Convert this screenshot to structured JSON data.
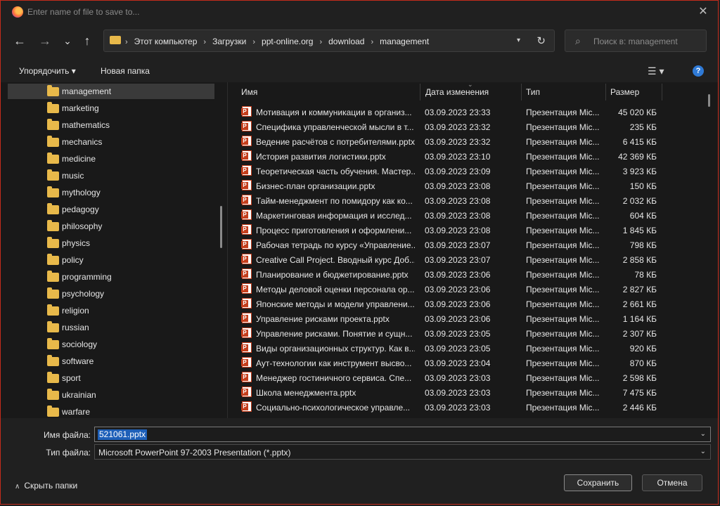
{
  "titlebar": {
    "title": "Enter name of file to save to..."
  },
  "nav": {
    "back": "←",
    "forward": "→",
    "recent": "⌄",
    "up": "↑"
  },
  "address": {
    "crumbs": [
      "Этот компьютер",
      "Загрузки",
      "ppt-online.org",
      "download",
      "management"
    ],
    "refresh": "↻"
  },
  "search": {
    "placeholder": "Поиск в: management"
  },
  "toolbar": {
    "organize_label": "Упорядочить ▾",
    "new_folder_label": "Новая папка",
    "help": "?"
  },
  "sidebar": {
    "selected_index": 0,
    "items": [
      {
        "label": "management"
      },
      {
        "label": "marketing"
      },
      {
        "label": "mathematics"
      },
      {
        "label": "mechanics"
      },
      {
        "label": "medicine"
      },
      {
        "label": "music"
      },
      {
        "label": "mythology"
      },
      {
        "label": "pedagogy"
      },
      {
        "label": "philosophy"
      },
      {
        "label": "physics"
      },
      {
        "label": "policy"
      },
      {
        "label": "programming"
      },
      {
        "label": "psychology"
      },
      {
        "label": "religion"
      },
      {
        "label": "russian"
      },
      {
        "label": "sociology"
      },
      {
        "label": "software"
      },
      {
        "label": "sport"
      },
      {
        "label": "ukrainian"
      },
      {
        "label": "warfare"
      }
    ]
  },
  "filelist": {
    "columns": {
      "name": "Имя",
      "date": "Дата изменения",
      "type": "Тип",
      "size": "Размер"
    },
    "rows": [
      {
        "name": "Мотивация и коммуникации в организ...",
        "date": "03.09.2023 23:33",
        "type": "Презентация Mic...",
        "size": "45 020 КБ"
      },
      {
        "name": "Специфика управленческой мысли в т...",
        "date": "03.09.2023 23:32",
        "type": "Презентация Mic...",
        "size": "235 КБ"
      },
      {
        "name": "Ведение расчётов с потребителями.pptx",
        "date": "03.09.2023 23:32",
        "type": "Презентация Mic...",
        "size": "6 415 КБ"
      },
      {
        "name": "История развития логистики.pptx",
        "date": "03.09.2023 23:10",
        "type": "Презентация Mic...",
        "size": "42 369 КБ"
      },
      {
        "name": "Теоретическая часть обучения. Мастер...",
        "date": "03.09.2023 23:09",
        "type": "Презентация Mic...",
        "size": "3 923 КБ"
      },
      {
        "name": "Бизнес-план организации.pptx",
        "date": "03.09.2023 23:08",
        "type": "Презентация Mic...",
        "size": "150 КБ"
      },
      {
        "name": "Тайм-менеджмент по помидору как ко...",
        "date": "03.09.2023 23:08",
        "type": "Презентация Mic...",
        "size": "2 032 КБ"
      },
      {
        "name": "Маркетинговая информация и исслед...",
        "date": "03.09.2023 23:08",
        "type": "Презентация Mic...",
        "size": "604 КБ"
      },
      {
        "name": "Процесс приготовления и оформлени...",
        "date": "03.09.2023 23:08",
        "type": "Презентация Mic...",
        "size": "1 845 КБ"
      },
      {
        "name": "Рабочая тетрадь по курсу «Управление...",
        "date": "03.09.2023 23:07",
        "type": "Презентация Mic...",
        "size": "798 КБ"
      },
      {
        "name": "Creative Call Project. Вводный курс Доб...",
        "date": "03.09.2023 23:07",
        "type": "Презентация Mic...",
        "size": "2 858 КБ"
      },
      {
        "name": "Планирование и бюджетирование.pptx",
        "date": "03.09.2023 23:06",
        "type": "Презентация Mic...",
        "size": "78 КБ"
      },
      {
        "name": "Методы деловой оценки персонала ор...",
        "date": "03.09.2023 23:06",
        "type": "Презентация Mic...",
        "size": "2 827 КБ"
      },
      {
        "name": "Японские методы и модели управлени...",
        "date": "03.09.2023 23:06",
        "type": "Презентация Mic...",
        "size": "2 661 КБ"
      },
      {
        "name": "Управление рисками проекта.pptx",
        "date": "03.09.2023 23:06",
        "type": "Презентация Mic...",
        "size": "1 164 КБ"
      },
      {
        "name": "Управление рисками. Понятие и сущн...",
        "date": "03.09.2023 23:05",
        "type": "Презентация Mic...",
        "size": "2 307 КБ"
      },
      {
        "name": "Виды организационных структур. Как в...",
        "date": "03.09.2023 23:05",
        "type": "Презентация Mic...",
        "size": "920 КБ"
      },
      {
        "name": "Аут-технологии как инструмент высво...",
        "date": "03.09.2023 23:04",
        "type": "Презентация Mic...",
        "size": "870 КБ"
      },
      {
        "name": "Менеджер гостиничного сервиса. Спе...",
        "date": "03.09.2023 23:03",
        "type": "Презентация Mic...",
        "size": "2 598 КБ"
      },
      {
        "name": "Школа менеджмента.pptx",
        "date": "03.09.2023 23:03",
        "type": "Презентация Mic...",
        "size": "7 475 КБ"
      },
      {
        "name": "Социально-психологическое управле...",
        "date": "03.09.2023 23:03",
        "type": "Презентация Mic...",
        "size": "2 446 КБ"
      }
    ]
  },
  "form": {
    "filename_label": "Имя файла:",
    "filename_value": "521061.pptx",
    "filetype_label": "Тип файла:",
    "filetype_value": "Microsoft PowerPoint 97-2003 Presentation (*.pptx)"
  },
  "footer": {
    "hide_folders_label": "Скрыть папки",
    "save_label": "Сохранить",
    "cancel_label": "Отмена"
  },
  "colors": {
    "accent": "#1d5fb8",
    "frame": "#c42b1c",
    "folder": "#e8b94a",
    "background": "#202020"
  }
}
